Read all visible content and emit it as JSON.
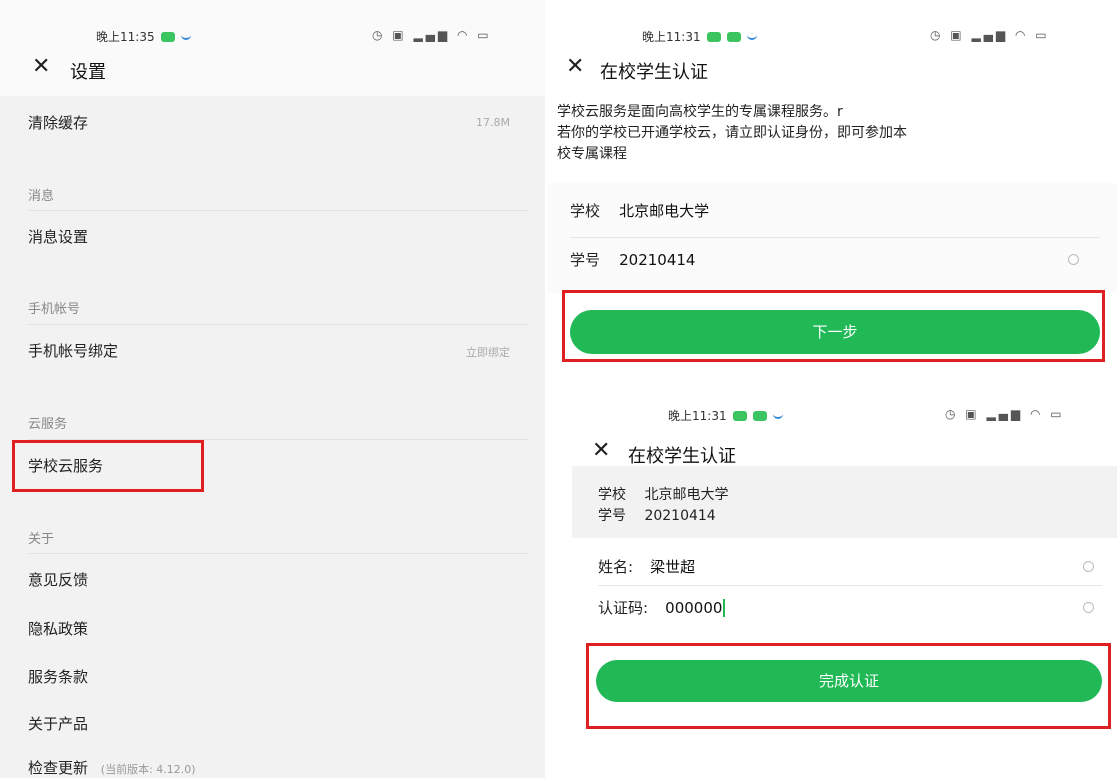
{
  "left": {
    "status_time": "晚上11:35",
    "title": "设置",
    "clear_cache": {
      "label": "清除缓存",
      "value": "17.8M"
    },
    "section_message": "消息",
    "message_settings": "消息设置",
    "section_phone": "手机帐号",
    "phone_binding": {
      "label": "手机帐号绑定",
      "value": "立即绑定"
    },
    "section_cloud": "云服务",
    "school_cloud": "学校云服务",
    "section_about": "关于",
    "feedback": "意见反馈",
    "privacy": "隐私政策",
    "terms": "服务条款",
    "about_product": "关于产品",
    "check_update": {
      "label": "检查更新",
      "version": "(当前版本: 4.12.0)"
    }
  },
  "right_top": {
    "status_time": "晚上11:31",
    "title": "在校学生认证",
    "intro_line1": "学校云服务是面向高校学生的专属课程服务。r",
    "intro_line2": "若你的学校已开通学校云，请立即认证身份，即可参加本",
    "intro_line3": "校专属课程",
    "school_label": "学校",
    "school_value": "北京邮电大学",
    "id_label": "学号",
    "id_value": "20210414",
    "next_button": "下一步"
  },
  "right_bottom": {
    "status_time": "晚上11:31",
    "title": "在校学生认证",
    "school_label": "学校",
    "school_value": "北京邮电大学",
    "id_label": "学号",
    "id_value": "20210414",
    "name_label": "姓名:",
    "name_value": "梁世超",
    "code_label": "认证码:",
    "code_value": "000000",
    "finish_button": "完成认证"
  },
  "colors": {
    "accent_green": "#21b856",
    "highlight_red": "#e02020"
  },
  "icons": [
    "close-icon",
    "clear-icon",
    "battery-icon",
    "wifi-icon",
    "signal-icon",
    "alarm-icon"
  ]
}
